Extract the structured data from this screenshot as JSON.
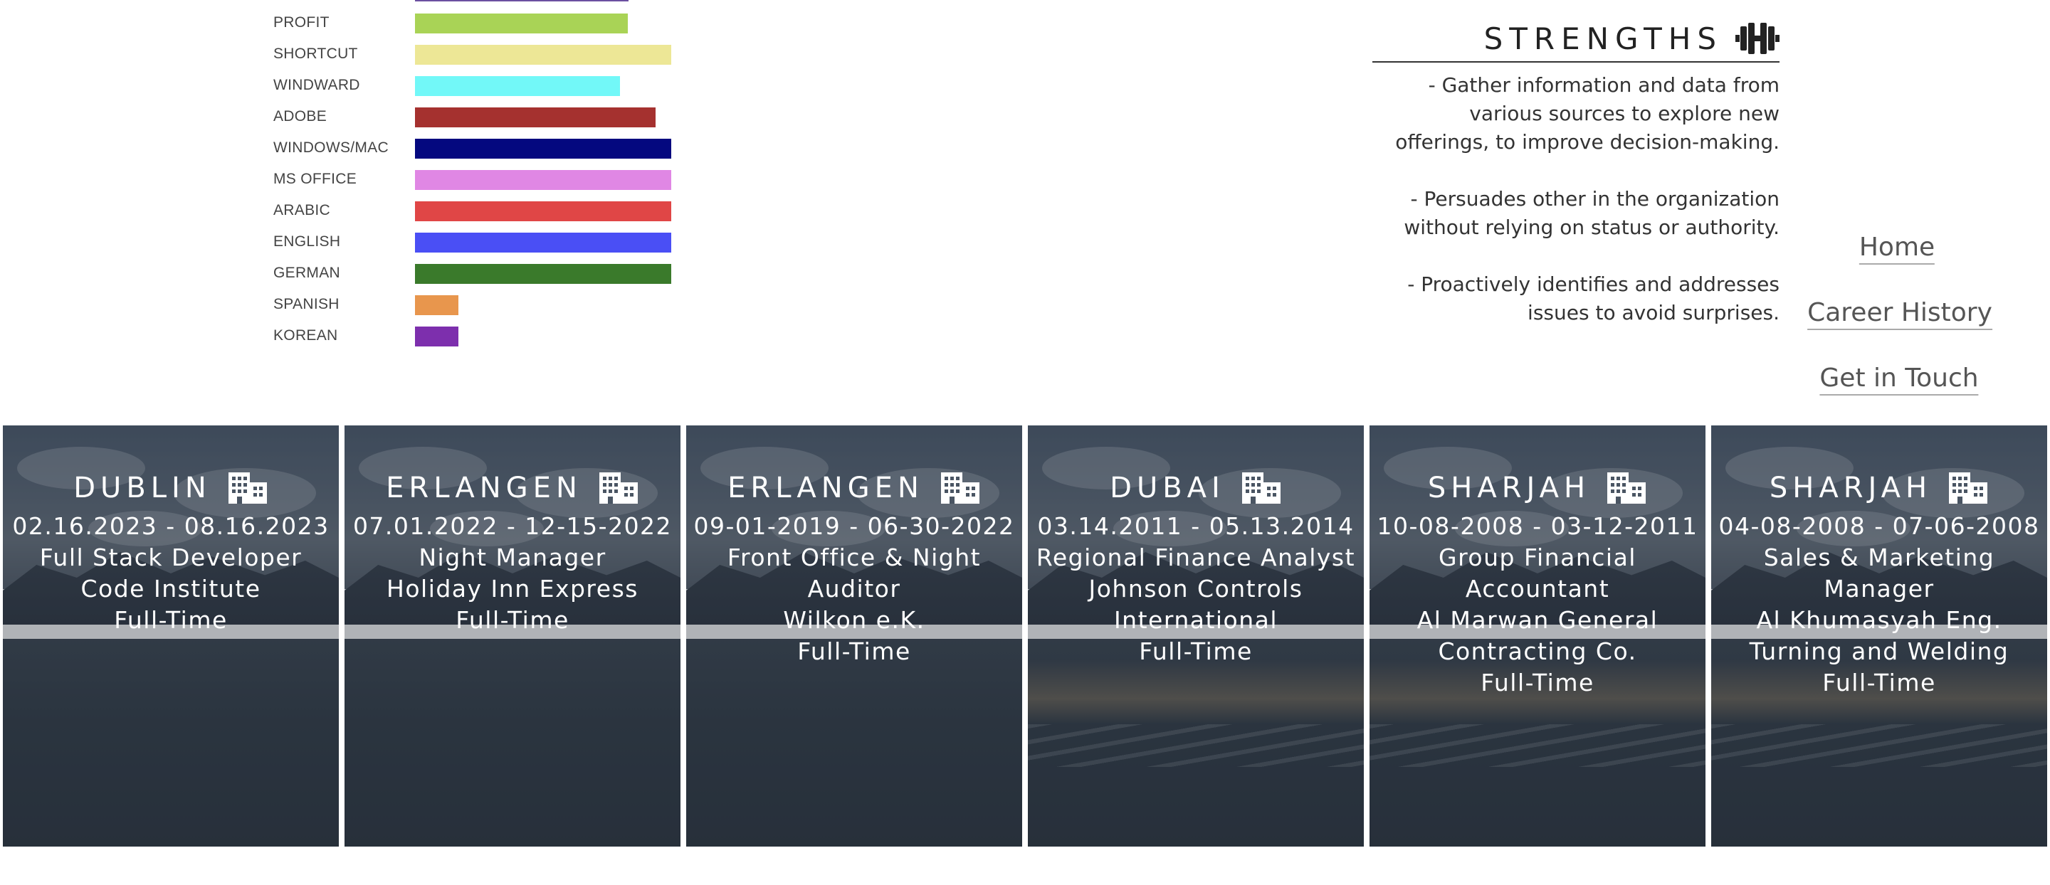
{
  "skills": [
    {
      "label": "PROFIT",
      "level": 0.83,
      "color": "#a9d356"
    },
    {
      "label": "SHORTCUT",
      "level": 1.0,
      "color": "#ede796"
    },
    {
      "label": "WINDWARD",
      "level": 0.8,
      "color": "#72f8f8"
    },
    {
      "label": "ADOBE",
      "level": 0.94,
      "color": "#a5312f"
    },
    {
      "label": "WINDOWS/MAC",
      "level": 1.0,
      "color": "#04087f"
    },
    {
      "label": "MS OFFICE",
      "level": 1.0,
      "color": "#e087e4"
    },
    {
      "label": "ARABIC",
      "level": 1.0,
      "color": "#e04646"
    },
    {
      "label": "ENGLISH",
      "level": 1.0,
      "color": "#4a4ff5"
    },
    {
      "label": "GERMAN",
      "level": 1.0,
      "color": "#3a7a2b"
    },
    {
      "label": "SPANISH",
      "level": 0.17,
      "color": "#e8964d"
    },
    {
      "label": "KOREAN",
      "level": 0.17,
      "color": "#7d2fad"
    }
  ],
  "strengths": {
    "title": "STRENGTHS",
    "icon": "dumbbell-icon",
    "items": [
      "- Gather information and data from\nvarious sources to explore new\nofferings, to improve decision-making.",
      "- Persuades other in the organization\nwithout relying on status or authority.",
      "- Proactively identifies and addresses\nissues to avoid surprises."
    ]
  },
  "nav": {
    "home": "Home",
    "career_history": "Career History",
    "get_in_touch": "Get in Touch"
  },
  "career": [
    {
      "city": "DUBLIN",
      "dates": "02.16.2023 - 08.16.2023",
      "lines": [
        "Full Stack Developer",
        "Code Institute",
        "Full-Time"
      ]
    },
    {
      "city": "ERLANGEN",
      "dates": "07.01.2022 - 12-15-2022",
      "lines": [
        "Night Manager",
        "Holiday Inn Express",
        "Full-Time"
      ]
    },
    {
      "city": "ERLANGEN",
      "dates": "09-01-2019 - 06-30-2022",
      "lines": [
        "Front Office & Night",
        "Auditor",
        "Wilkon e.K.",
        "Full-Time"
      ]
    },
    {
      "city": "DUBAI",
      "dates": "03.14.2011 - 05.13.2014",
      "lines": [
        "Regional Finance Analyst",
        "Johnson Controls",
        "International",
        "Full-Time"
      ]
    },
    {
      "city": "SHARJAH",
      "dates": "10-08-2008 - 03-12-2011",
      "lines": [
        "Group Financial",
        "Accountant",
        "Al Marwan General",
        "Contracting Co.",
        "Full-Time"
      ]
    },
    {
      "city": "SHARJAH",
      "dates": "04-08-2008 - 07-06-2008",
      "lines": [
        "Sales & Marketing",
        "Manager",
        "Al Khumasyah Eng.",
        "Turning and Welding",
        "Full-Time"
      ]
    }
  ]
}
